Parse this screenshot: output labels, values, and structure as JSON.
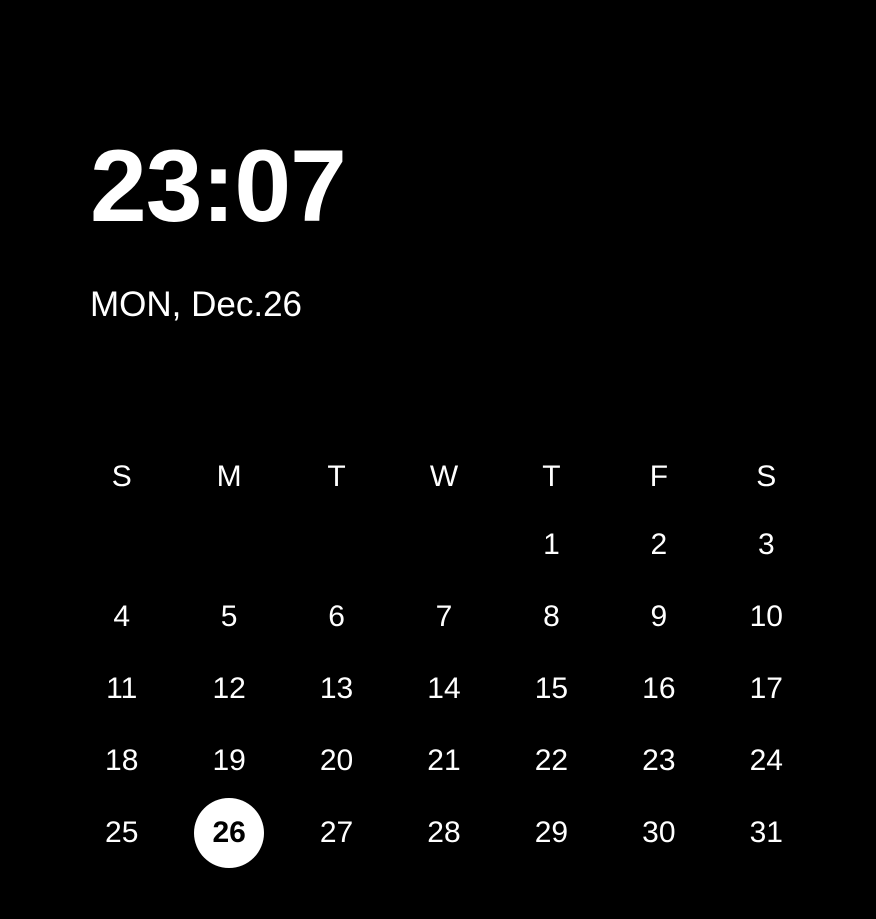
{
  "clock": {
    "time": "23:07",
    "date_line": "MON, Dec.26"
  },
  "calendar": {
    "weekdays": [
      "S",
      "M",
      "T",
      "W",
      "T",
      "F",
      "S"
    ],
    "weeks": [
      [
        "",
        "",
        "",
        "",
        "1",
        "2",
        "3"
      ],
      [
        "4",
        "5",
        "6",
        "7",
        "8",
        "9",
        "10"
      ],
      [
        "11",
        "12",
        "13",
        "14",
        "15",
        "16",
        "17"
      ],
      [
        "18",
        "19",
        "20",
        "21",
        "22",
        "23",
        "24"
      ],
      [
        "25",
        "26",
        "27",
        "28",
        "29",
        "30",
        "31"
      ]
    ],
    "today": "26"
  }
}
